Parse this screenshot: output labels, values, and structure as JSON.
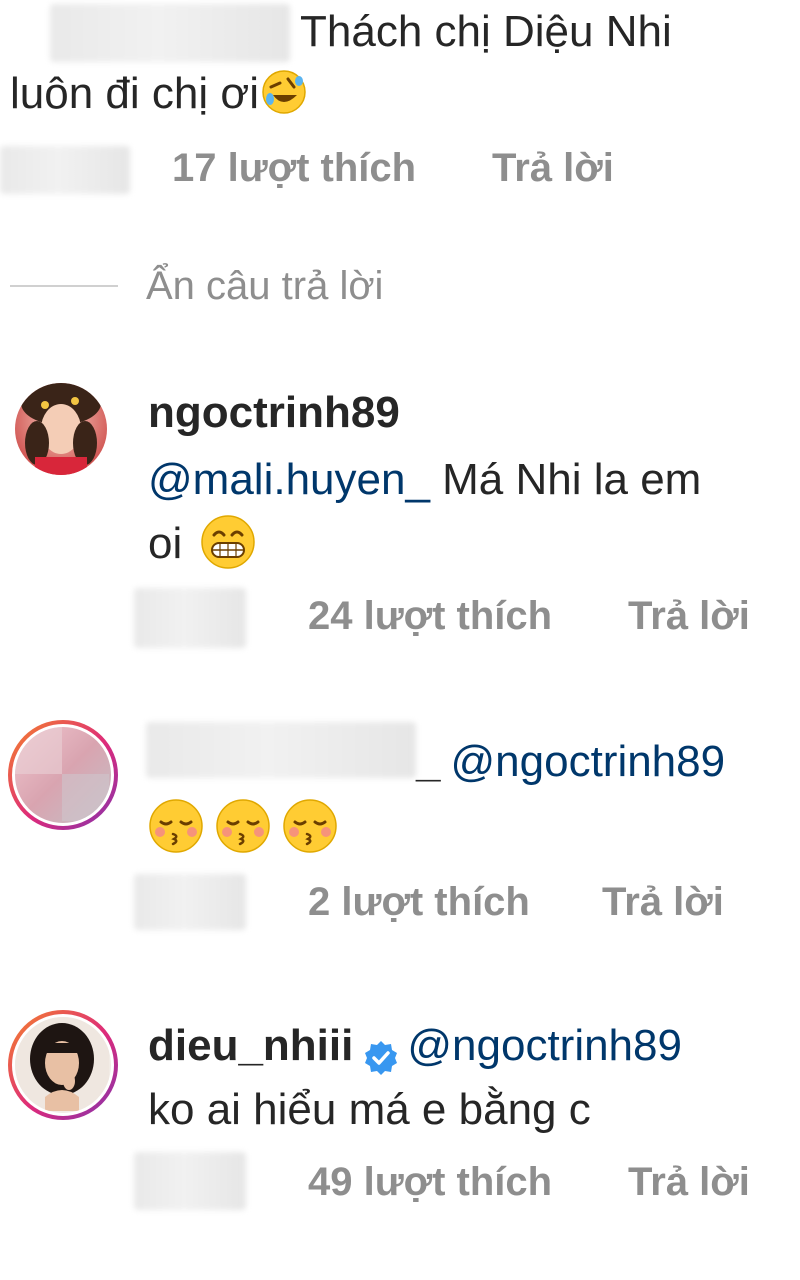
{
  "comment1": {
    "text_line1": "Thách chị Diệu Nhi",
    "text_line2": "luôn đi chị ơi",
    "emoji": "rolling-on-floor-laughing",
    "likes": "17 lượt thích",
    "reply": "Trả lời"
  },
  "hide_replies_label": "Ẩn câu trả lời",
  "reply1": {
    "username": "ngoctrinh89",
    "mention": "@mali.huyen_",
    "text_after_mention": " Má Nhi la em",
    "text_line2": "oi",
    "emoji": "grinning-face",
    "likes": "24 lượt thích",
    "reply": "Trả lời"
  },
  "reply2": {
    "username_suffix": "_",
    "mention": "@ngoctrinh89",
    "emojis": [
      "kissing-face-with-closed-eyes",
      "kissing-face-with-closed-eyes",
      "kissing-face-with-closed-eyes"
    ],
    "likes": "2 lượt thích",
    "reply": "Trả lời"
  },
  "reply3": {
    "username": "dieu_nhiii",
    "verified_icon": "verified-badge-icon",
    "mention": "@ngoctrinh89",
    "text": "ko ai hiểu má e bằng c",
    "likes": "49 lượt thích",
    "reply": "Trả lời"
  },
  "colors": {
    "text": "#262626",
    "meta": "#8e8e8e",
    "mention": "#00376b",
    "verified": "#3897f0",
    "emoji_yellow": "#ffcc33"
  }
}
